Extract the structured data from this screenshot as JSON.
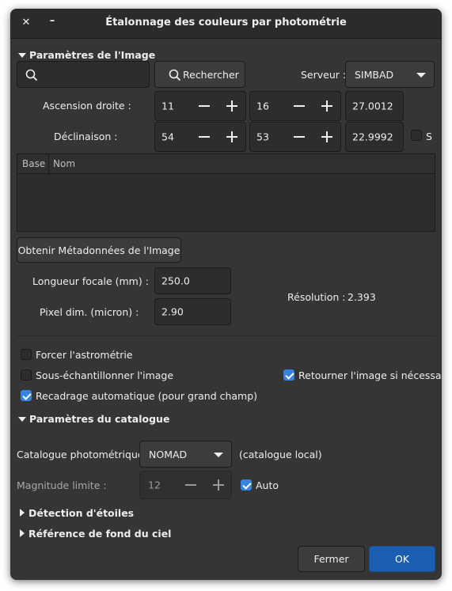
{
  "window": {
    "title": "Étalonnage des couleurs par photométrie",
    "close_glyph": "✕",
    "minimize_glyph": "–"
  },
  "image_params": {
    "section_label": "Paramètres de l'Image",
    "search_value": "",
    "search_button": "Rechercher",
    "server_label": "Serveur :",
    "server_value": "SIMBAD",
    "ra_label": "Ascension droite :",
    "ra_h": "11",
    "ra_m": "16",
    "ra_s": "27.0012",
    "dec_label": "Déclinaison :",
    "dec_d": "54",
    "dec_m": "53",
    "dec_s": "22.9992",
    "south_label": "S",
    "table_headers": [
      "Base",
      "Nom"
    ],
    "metadata_button": "Obtenir Métadonnées de l'Image",
    "focal_label": "Longueur focale (mm) :",
    "focal_value": "250.0",
    "pixel_label": "Pixel dim. (micron) :",
    "pixel_value": "2.90",
    "resolution_label": "Résolution :",
    "resolution_value": "2.393"
  },
  "options": {
    "force_astrometry": {
      "label": "Forcer l'astrométrie",
      "checked": false
    },
    "downsample": {
      "label": "Sous-échantillonner l'image",
      "checked": false
    },
    "flip": {
      "label": "Retourner l'image si nécessaire",
      "checked": true
    },
    "autocrop": {
      "label": "Recadrage automatique (pour grand champ)",
      "checked": true
    }
  },
  "catalog": {
    "section_label": "Paramètres du catalogue",
    "catalog_label": "Catalogue photométrique :",
    "catalog_value": "NOMAD",
    "catalog_note": "(catalogue local)",
    "maglimit_label": "Magnitude limite :",
    "maglimit_value": "12",
    "auto_label": "Auto"
  },
  "collapsed_sections": {
    "star_detection": "Détection d'étoiles",
    "sky_background": "Référence de fond du ciel"
  },
  "footer": {
    "close_button": "Fermer",
    "ok_button": "OK"
  },
  "colors": {
    "accent": "#3584e4",
    "window_bg": "#353535",
    "titlebar_bg": "#2b2b2b"
  }
}
